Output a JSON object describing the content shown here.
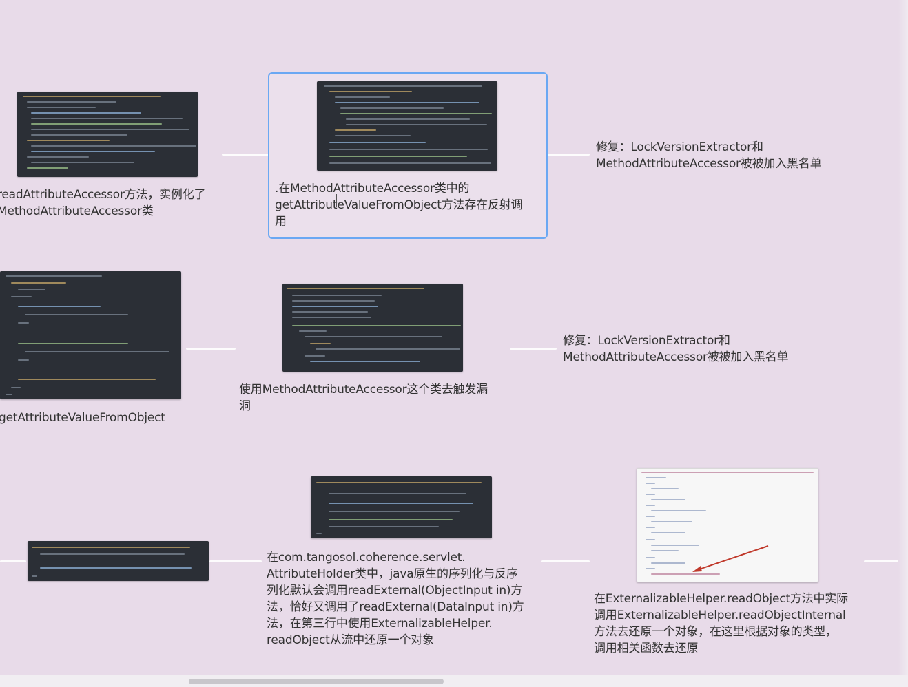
{
  "mindmap": {
    "row1": {
      "left_text": "readAttributeAccessor方法，实例化了\nMethodAttributeAccessor类",
      "center_text": ".在MethodAttributeAccessor类中的\ngetAttributeValueFromObject方法存在反射调\n用",
      "right_text": "修复：LockVersionExtractor和\nMethodAttributeAccessor被被加入黑名单"
    },
    "row2": {
      "left_text": "getAttributeValueFromObject",
      "center_text": "使用MethodAttributeAccessor这个类去触发漏\n洞",
      "right_text": "修复：LockVersionExtractor和\nMethodAttributeAccessor被被加入黑名单"
    },
    "row3": {
      "center_text": "在com.tangosol.coherence.servlet.\nAttributeHolder类中，java原生的序列化与反序\n列化默认会调用readExternal(ObjectInput in)方\n法，恰好又调用了readExternal(DataInput in)方\n法，在第三行中使用ExternalizableHelper.\nreadObject从流中还原一个对象",
      "right_text": "在ExternalizableHelper.readObject方法中实际\n调用ExternalizableHelper.readObjectInternal\n方法去还原一个对象，在这里根据对象的类型，\n调用相关函数去还原"
    }
  },
  "colors": {
    "background": "#e8dbe9",
    "selection_border": "#6aa8f3",
    "code_background": "#2b2f36",
    "connector": "#ffffff",
    "arrow": "#c0392b"
  },
  "icons": [
    "text-cursor-icon",
    "red-arrow-icon"
  ]
}
